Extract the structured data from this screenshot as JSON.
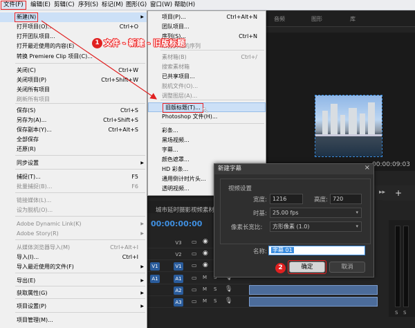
{
  "menubar": {
    "items": [
      "文件(F)",
      "编辑(E)",
      "剪辑(C)",
      "序列(S)",
      "标记(M)",
      "图形(G)",
      "窗口(W)",
      "帮助(H)"
    ]
  },
  "file_menu": {
    "items": [
      {
        "label": "新建(N)",
        "shortcut": "",
        "arrow": true,
        "state": "highlight"
      },
      {
        "label": "打开项目(O)...",
        "shortcut": "Ctrl+O"
      },
      {
        "label": "打开团队项目...",
        "shortcut": ""
      },
      {
        "label": "打开最近使用的内容(E)",
        "shortcut": "",
        "arrow": true
      },
      {
        "label": "转换 Premiere Clip 项目(C)...",
        "shortcut": ""
      },
      {
        "label": "关闭(C)",
        "shortcut": "Ctrl+W"
      },
      {
        "label": "关闭项目(P)",
        "shortcut": "Ctrl+Shift+W"
      },
      {
        "label": "关闭所有项目",
        "shortcut": ""
      },
      {
        "label": "刷新所有项目",
        "shortcut": "",
        "state": "disabled"
      },
      {
        "label": "保存(S)",
        "shortcut": "Ctrl+S"
      },
      {
        "label": "另存为(A)...",
        "shortcut": "Ctrl+Shift+S"
      },
      {
        "label": "保存副本(Y)...",
        "shortcut": "Ctrl+Alt+S"
      },
      {
        "label": "全部保存",
        "shortcut": ""
      },
      {
        "label": "还原(R)",
        "shortcut": ""
      },
      {
        "label": "同步设置",
        "shortcut": "",
        "arrow": true
      },
      {
        "label": "捕捉(T)...",
        "shortcut": "F5"
      },
      {
        "label": "批量捕捉(B)...",
        "shortcut": "F6",
        "state": "disabled"
      },
      {
        "label": "链接媒体(L)...",
        "shortcut": "",
        "state": "disabled"
      },
      {
        "label": "设为脱机(O)...",
        "shortcut": "",
        "state": "disabled"
      },
      {
        "label": "Adobe Dynamic Link(K)",
        "shortcut": "",
        "arrow": true,
        "state": "disabled"
      },
      {
        "label": "Adobe Story(R)",
        "shortcut": "",
        "arrow": true,
        "state": "disabled"
      },
      {
        "label": "从媒体浏览器导入(M)",
        "shortcut": "Ctrl+Alt+I",
        "state": "disabled"
      },
      {
        "label": "导入(I)...",
        "shortcut": "Ctrl+I"
      },
      {
        "label": "导入最近使用的文件(F)",
        "shortcut": "",
        "arrow": true
      },
      {
        "label": "导出(E)",
        "shortcut": "",
        "arrow": true
      },
      {
        "label": "获取属性(G)",
        "shortcut": "",
        "arrow": true
      },
      {
        "label": "项目设置(P)",
        "shortcut": "",
        "arrow": true
      },
      {
        "label": "项目管理(M)...",
        "shortcut": ""
      }
    ]
  },
  "new_submenu": {
    "items": [
      {
        "label": "项目(P)...",
        "shortcut": "Ctrl+Alt+N"
      },
      {
        "label": "团队项目...",
        "shortcut": ""
      },
      {
        "label": "序列(S)...",
        "shortcut": "Ctrl+N"
      },
      {
        "label": "来自剪辑的序列",
        "shortcut": "",
        "state": "disabled"
      },
      {
        "label": "素材箱(B)",
        "shortcut": "Ctrl+/",
        "state": "disabled"
      },
      {
        "label": "搜索素材箱",
        "shortcut": "",
        "state": "disabled"
      },
      {
        "label": "已共享项目...",
        "shortcut": ""
      },
      {
        "label": "脱机文件(O)...",
        "shortcut": "",
        "state": "disabled"
      },
      {
        "label": "调整图层(A)...",
        "shortcut": "",
        "state": "disabled"
      },
      {
        "label": "旧版标题(T)...",
        "shortcut": "",
        "state": "hover"
      },
      {
        "label": "Photoshop 文件(H)...",
        "shortcut": ""
      },
      {
        "label": "彩条...",
        "shortcut": ""
      },
      {
        "label": "黑场视频...",
        "shortcut": ""
      },
      {
        "label": "字幕...",
        "shortcut": ""
      },
      {
        "label": "颜色遮罩...",
        "shortcut": ""
      },
      {
        "label": "HD 彩条...",
        "shortcut": ""
      },
      {
        "label": "通用倒计时片头...",
        "shortcut": ""
      },
      {
        "label": "透明视频...",
        "shortcut": ""
      }
    ]
  },
  "annotation": {
    "step1_num": "1",
    "step1_text": "文件 - 新建 - 旧版标题",
    "step2_num": "2",
    "color": "#e02020"
  },
  "right_tabs": [
    "音频",
    "图形",
    "库"
  ],
  "monitor": {
    "timecode": "00:00:09:03"
  },
  "timeline": {
    "title": "城市延时摄影视频素材",
    "timecode": "00:00:00:00",
    "video_tracks": [
      "V3",
      "V2",
      "V1"
    ],
    "audio_tracks": [
      "A1",
      "A2",
      "A3"
    ],
    "source_v": "V1",
    "source_a": "A1"
  },
  "dialog": {
    "title": "新建字幕",
    "close": "×",
    "group_label": "视频设置",
    "width_label": "宽度:",
    "width_value": "1216",
    "height_label": "高度:",
    "height_value": "720",
    "timebase_label": "时基:",
    "timebase_value": "25.00 fps",
    "par_label": "像素长宽比:",
    "par_value": "方形像素 (1.0)",
    "name_label": "名称:",
    "name_value": "字幕 01",
    "ok": "确定",
    "cancel": "取消"
  }
}
